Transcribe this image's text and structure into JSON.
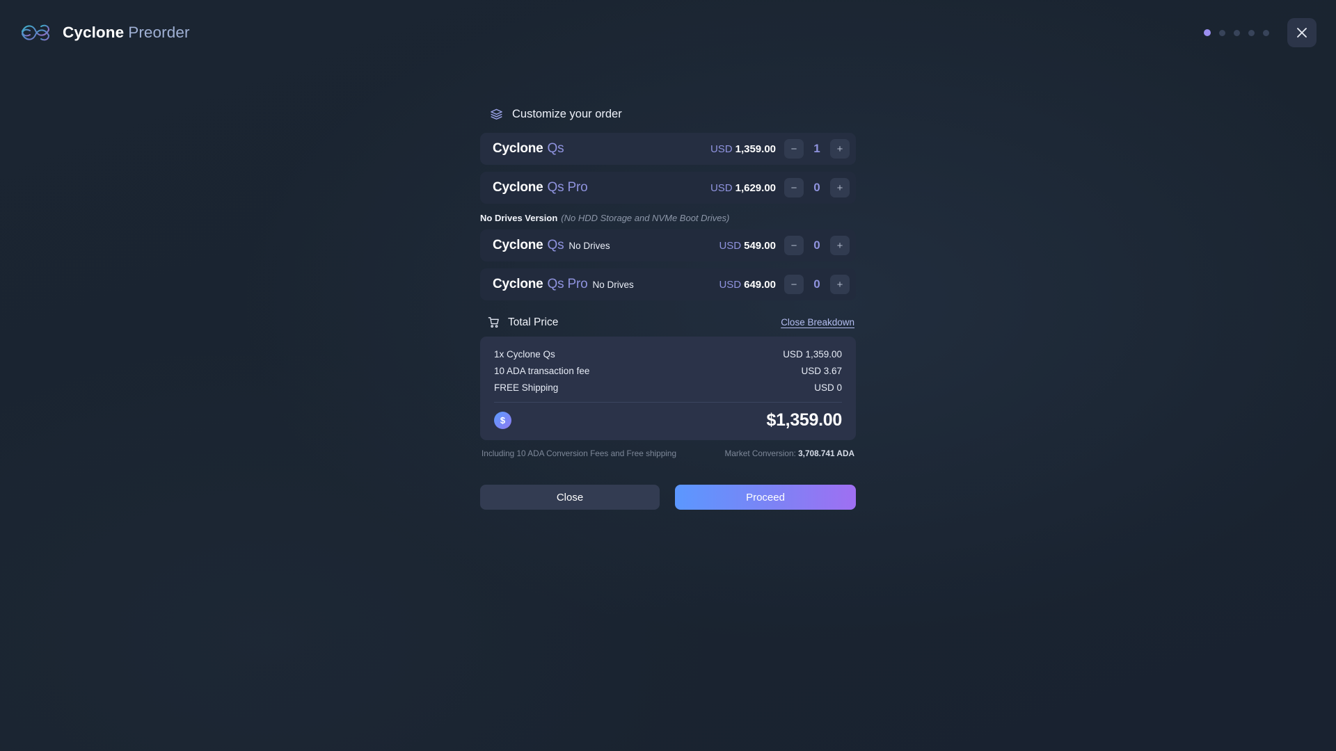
{
  "brand": {
    "name": "Cyclone",
    "suffix": "Preorder",
    "logo_icon": "cyclone-wave-logo"
  },
  "topbar": {
    "steps": {
      "total": 5,
      "active_index": 0
    },
    "close_icon": "close-x-icon"
  },
  "section": {
    "icon": "layers-stack-icon",
    "title": "Customize your order"
  },
  "products": [
    {
      "name_primary": "Cyclone",
      "name_secondary": "Qs",
      "name_tertiary": "",
      "currency": "USD",
      "price": "1,359.00",
      "quantity": "1",
      "minus_label": "−",
      "plus_label": "+",
      "highlighted": true
    },
    {
      "name_primary": "Cyclone",
      "name_secondary": "Qs Pro",
      "name_tertiary": "",
      "currency": "USD",
      "price": "1,629.00",
      "quantity": "0",
      "minus_label": "−",
      "plus_label": "+",
      "highlighted": false
    }
  ],
  "no_drives": {
    "heading": "No Drives Version",
    "note": "(No HDD Storage and NVMe Boot Drives)",
    "products": [
      {
        "name_primary": "Cyclone",
        "name_secondary": "Qs",
        "name_tertiary": "No Drives",
        "currency": "USD",
        "price": "549.00",
        "quantity": "0",
        "minus_label": "−",
        "plus_label": "+"
      },
      {
        "name_primary": "Cyclone",
        "name_secondary": "Qs Pro",
        "name_tertiary": "No Drives",
        "currency": "USD",
        "price": "649.00",
        "quantity": "0",
        "minus_label": "−",
        "plus_label": "+"
      }
    ]
  },
  "total": {
    "icon": "shopping-cart-icon",
    "title": "Total Price",
    "breakdown_toggle": "Close Breakdown",
    "lines": [
      {
        "label": "1x Cyclone Qs",
        "value": "USD 1,359.00"
      },
      {
        "label": "10 ADA transaction fee",
        "value": "USD 3.67"
      },
      {
        "label": "FREE Shipping",
        "value": "USD 0"
      }
    ],
    "coin_symbol": "$",
    "grand_total": "$1,359.00",
    "footnote_left": "Including 10 ADA Conversion Fees and Free shipping",
    "footnote_right_label": "Market Conversion:",
    "footnote_right_value": "3,708.741 ADA"
  },
  "actions": {
    "close_label": "Close",
    "proceed_label": "Proceed"
  },
  "colors": {
    "background": "#1b2532",
    "row": "#252e41",
    "row_alt": "#222b3d",
    "accent_purple": "#8f93de",
    "link": "#b4bdf0",
    "breakdown_card": "#2b3349",
    "proceed_from": "#5b97ff",
    "proceed_to": "#9f6ff2"
  }
}
